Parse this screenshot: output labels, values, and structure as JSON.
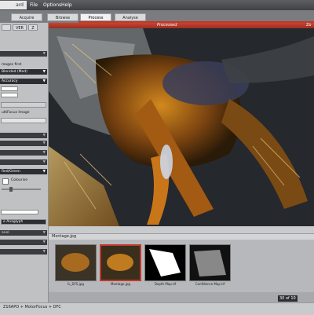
{
  "title": "ard",
  "menu": [
    "File",
    "Options",
    "Help"
  ],
  "workflow_tabs": [
    "Acquire",
    "Browse",
    "Process",
    "Analyse"
  ],
  "active_tab": "Process",
  "panel": {
    "tabs": [
      "",
      "VER",
      "Z"
    ],
    "text_labels": {
      "images_first": "mages first",
      "blended": "Blended (Med)",
      "accuracy": "Accuracy",
      "multifocus": "ultiFocus Image",
      "colourise": "Colourise",
      "red_green": "Red/Green",
      "anaglyph": "e Anaglyph",
      "panel_label": "anel"
    }
  },
  "viewer": {
    "header_label": "Processed",
    "header_right": "Zo"
  },
  "strip": {
    "title": "Montage.jpg",
    "thumbs": [
      {
        "caption": "IL_DFS.jpg"
      },
      {
        "caption": "Montage.jpg"
      },
      {
        "caption": "Depth Map.tif"
      },
      {
        "caption": "Confidence Map.tif"
      }
    ],
    "page_info": "30 of 10"
  },
  "status": "Z16APO + MotorFocus + DFC",
  "colors": {
    "accent": "#c0392b"
  }
}
